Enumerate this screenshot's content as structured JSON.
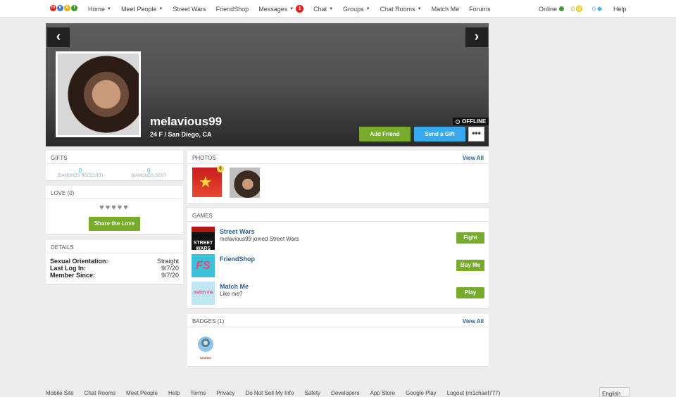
{
  "nav": {
    "logo": [
      "m",
      "e",
      "e",
      "t"
    ],
    "items": [
      {
        "label": "Home",
        "caret": true
      },
      {
        "label": "Meet People",
        "caret": true
      },
      {
        "label": "Street Wars",
        "caret": false
      },
      {
        "label": "FriendShop",
        "caret": false
      },
      {
        "label": "Messages",
        "caret": true,
        "badge": "1"
      },
      {
        "label": "Chat",
        "caret": true
      },
      {
        "label": "Groups",
        "caret": true
      },
      {
        "label": "Chat Rooms",
        "caret": true
      },
      {
        "label": "Match Me",
        "caret": false
      },
      {
        "label": "Forums",
        "caret": false
      }
    ],
    "status": "Online",
    "coins": "0",
    "diamonds": "0",
    "help": "Help",
    "messages_badge": "1"
  },
  "profile": {
    "username": "melavious99",
    "info": "24 F / San Diego, CA",
    "status": "OFFLINE",
    "add_friend": "Add Friend",
    "send_gift": "Send a Gift",
    "more": "•••"
  },
  "gifts": {
    "title": "GIFTS",
    "received_count": "0",
    "received_label": "DIAMONDS RECEIVED",
    "sent_count": "0",
    "sent_label": "DIAMONDS SENT"
  },
  "love": {
    "title": "LOVE (0)",
    "hearts": "♥♥♥♥♥",
    "button": "Share the Love"
  },
  "details": {
    "title": "DETAILS",
    "rows": [
      {
        "label": "Sexual Orientation:",
        "value": "Straight"
      },
      {
        "label": "Last Log In:",
        "value": "9/7/20"
      },
      {
        "label": "Member Since:",
        "value": "9/7/20"
      }
    ]
  },
  "photos": {
    "title": "PHOTOS",
    "view_all": "View All",
    "badge": "0"
  },
  "games": {
    "title": "GAMES",
    "items": [
      {
        "title": "Street Wars",
        "subtitle": "melavious99 joined Street Wars",
        "button": "Fight",
        "icon_text": "STREET WARS"
      },
      {
        "title": "FriendShop",
        "subtitle": "",
        "button": "Buy Me",
        "icon_text": "FS"
      },
      {
        "title": "Match Me",
        "subtitle": "Like me?",
        "button": "Play",
        "icon_text": "match me"
      }
    ]
  },
  "badges": {
    "title": "BADGES (1)",
    "view_all": "View All",
    "badge_label": "NEWBIE"
  },
  "footer": {
    "links": [
      "Mobile Site",
      "Chat Rooms",
      "Meet People",
      "Help",
      "Terms",
      "Privacy",
      "Do Not Sell My Info",
      "Safety",
      "Developers",
      "App Store",
      "Google Play",
      "Logout (m1chael777)"
    ],
    "language": "English"
  }
}
